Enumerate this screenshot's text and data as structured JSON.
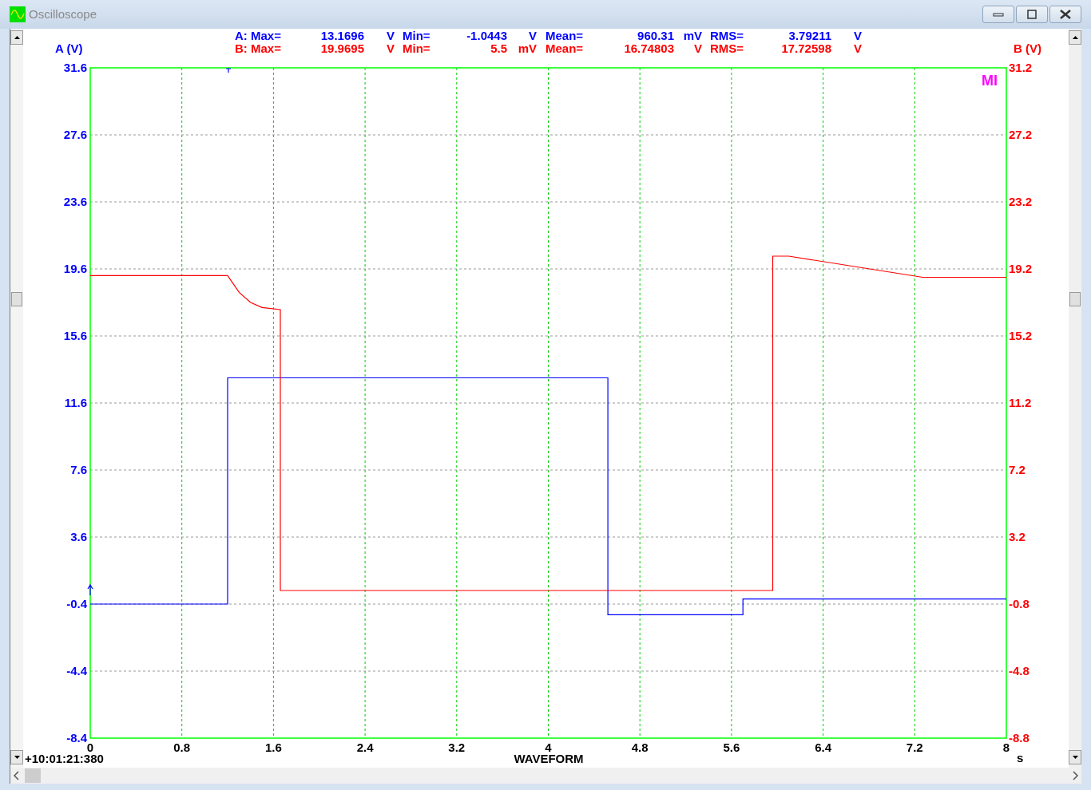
{
  "window": {
    "title": "Oscilloscope"
  },
  "stats": [
    {
      "color": "#0000ff",
      "items": [
        {
          "label": "A: Max=",
          "value": "13.1696",
          "unit": "V"
        },
        {
          "label": "Min=",
          "value": "-1.0443",
          "unit": "V"
        },
        {
          "label": "Mean=",
          "value": "960.31",
          "unit": "mV"
        },
        {
          "label": "RMS=",
          "value": "3.79211",
          "unit": "V"
        }
      ]
    },
    {
      "color": "#ff0000",
      "items": [
        {
          "label": "B: Max=",
          "value": "19.9695",
          "unit": "V"
        },
        {
          "label": "Min=",
          "value": "5.5",
          "unit": "mV"
        },
        {
          "label": "Mean=",
          "value": "16.74803",
          "unit": "V"
        },
        {
          "label": "RMS=",
          "value": "17.72598",
          "unit": "V"
        }
      ]
    }
  ],
  "marker_label": "MI",
  "timestamp": "+10:01:21:380",
  "x_unit": "s",
  "chart_data": {
    "type": "line",
    "xlabel": "WAVEFORM",
    "ylabel": "A (V)",
    "y2label": "B (V)",
    "grid": true,
    "xlim": [
      0,
      8
    ],
    "ylim": [
      -8.4,
      31.6
    ],
    "y2lim": [
      -8.8,
      31.2
    ],
    "xticks": [
      0,
      0.8,
      1.6,
      2.4,
      3.2,
      4,
      4.8,
      5.6,
      6.4,
      7.2,
      8
    ],
    "yticks": [
      31.6,
      27.6,
      23.6,
      19.6,
      15.6,
      11.6,
      7.6,
      3.6,
      -0.4,
      -4.4,
      -8.4
    ],
    "y2ticks": [
      31.2,
      27.2,
      23.2,
      19.2,
      15.2,
      11.2,
      7.2,
      3.2,
      -0.8,
      -4.8,
      -8.8
    ],
    "x": [
      0,
      1.2,
      1.2,
      1.3,
      1.4,
      1.5,
      1.66,
      1.66,
      4.52,
      4.52,
      5.7,
      5.7,
      5.96,
      5.96,
      6.1,
      7.27,
      8
    ],
    "series": [
      {
        "color": "#0000ff",
        "values": [
          -0.4,
          -0.4,
          13.1,
          13.1,
          13.1,
          13.1,
          13.1,
          13.1,
          13.1,
          -1.04,
          -1.04,
          -0.1,
          -0.1,
          -0.1,
          -0.1,
          -0.1,
          -0.1
        ]
      },
      {
        "color": "#ff0000",
        "axis": "y2",
        "values": [
          18.8,
          18.8,
          18.8,
          17.8,
          17.2,
          16.9,
          16.77,
          0.01,
          0.01,
          0.01,
          0.01,
          0.01,
          0.01,
          19.96,
          19.96,
          18.7,
          18.7
        ]
      }
    ]
  }
}
